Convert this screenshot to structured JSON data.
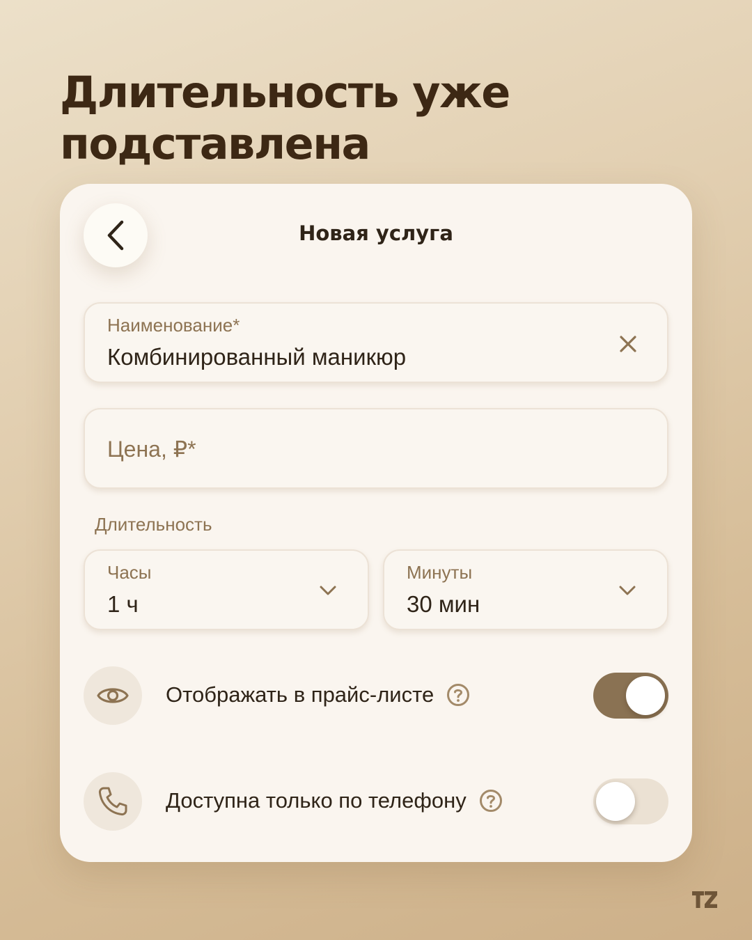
{
  "headline": {
    "line1": "Длительность уже",
    "line2": "подставлена"
  },
  "card": {
    "title": "Новая услуга",
    "back_icon": "chevron-left-icon"
  },
  "form": {
    "name_field": {
      "label": "Наименование*",
      "value": "Комбинированный маникюр",
      "clear_icon": "close-icon"
    },
    "price_field": {
      "placeholder": "Цена, ₽*"
    },
    "duration": {
      "label": "Длительность",
      "hours": {
        "label": "Часы",
        "value": "1 ч",
        "icon": "chevron-down-icon"
      },
      "minutes": {
        "label": "Минуты",
        "value": "30 мин",
        "icon": "chevron-down-icon"
      }
    }
  },
  "settings": [
    {
      "icon": "eye-icon",
      "label": "Отображать в прайс-листе",
      "help_icon": "help-circle-icon",
      "enabled": true
    },
    {
      "icon": "phone-icon",
      "label": "Доступна только по телефону",
      "help_icon": "help-circle-icon",
      "enabled": false
    }
  ],
  "colors": {
    "toggle_on": "#8a7253",
    "toggle_off": "#ebe1d3",
    "accent_text": "#8d7352",
    "headline": "#3d2814"
  },
  "brand": {
    "logo_text": "TZ"
  }
}
